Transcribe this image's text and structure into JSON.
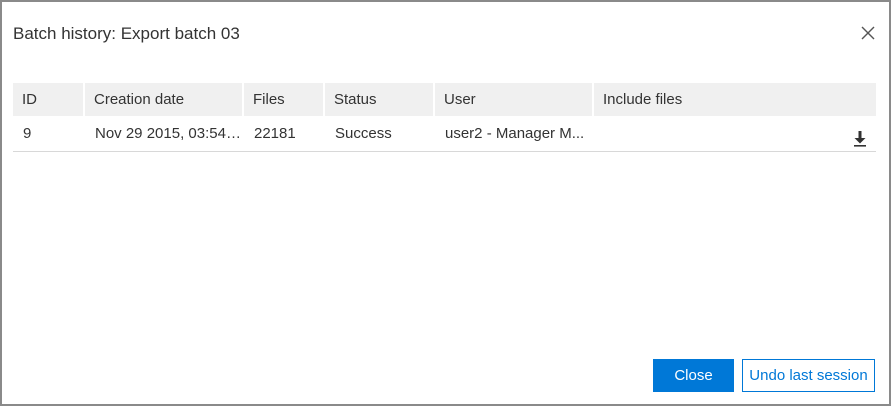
{
  "dialog": {
    "title": "Batch history: Export batch 03"
  },
  "table": {
    "columns": [
      "ID",
      "Creation date",
      "Files",
      "Status",
      "User",
      "Include files"
    ],
    "rows": [
      {
        "id": "9",
        "creation_date": "Nov 29 2015, 03:54 ...",
        "files": "22181",
        "status": "Success",
        "user": "user2 - Manager M...",
        "include_files": ""
      }
    ]
  },
  "buttons": {
    "close": "Close",
    "undo": "Undo last session"
  },
  "icons": {
    "close": "close-icon",
    "download": "download-icon"
  },
  "colors": {
    "accent": "#0078d7",
    "header_bg": "#f0f0f0",
    "border": "#8a8a8a"
  }
}
